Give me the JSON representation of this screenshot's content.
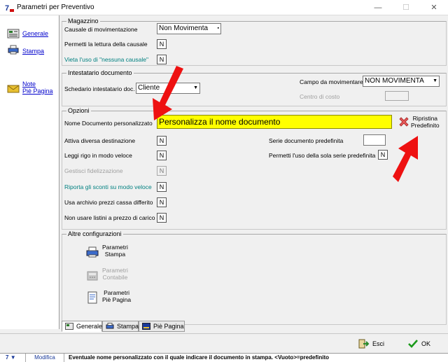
{
  "window": {
    "title": "Parametri per Preventivo",
    "minimize": "—",
    "maximize": "☐",
    "close": "✕"
  },
  "sidebar": {
    "items": [
      {
        "label": "Generale"
      },
      {
        "label": "Stampa"
      },
      {
        "label": "Note\nPiè Pagina"
      }
    ]
  },
  "magazzino": {
    "title": "Magazzino",
    "causale_label": "Causale di movimentazione",
    "causale_value": "Non Movimenta",
    "lettura_label": "Permetti la lettura della causale",
    "lettura_value": "N",
    "vieta_label": "Vieta l'uso di  \"nessuna causale\"",
    "vieta_value": "N"
  },
  "intestatario": {
    "title": "Intestatario documento",
    "schedario_label": "Schedario intestatario doc.",
    "schedario_value": "Cliente",
    "campo_label": "Campo da movimentare",
    "campo_value": "NON MOVIMENTA",
    "centro_label": "Centro di costo"
  },
  "opzioni": {
    "title": "Opzioni",
    "nome_label": "Nome Documento personalizzato",
    "nome_value": "Personalizza il nome documento",
    "ripristina_label": "Ripristina\nPredefinito",
    "destinazione_label": "Attiva diversa destinazione",
    "destinazione_value": "N",
    "rigo_label": "Leggi rigo in modo veloce",
    "rigo_value": "N",
    "fidel_label": "Gestisci fidelizzazione",
    "fidel_value": "N",
    "sconti_label": "Riporta gli sconti su modo veloce",
    "sconti_value": "N",
    "archivio_label": "Usa archivio prezzi cassa differito",
    "archivio_value": "N",
    "listini_label": "Non usare listini a prezzo di carico",
    "listini_value": "N",
    "serie_label": "Serie documento predefinita",
    "sola_serie_label": "Permetti l'uso della sola serie predefinita",
    "sola_serie_value": "N"
  },
  "altre": {
    "title": "Altre configurazioni",
    "items": [
      {
        "label": "Parametri\nStampa",
        "enabled": true
      },
      {
        "label": "Parametri\nContabile",
        "enabled": false
      },
      {
        "label": "Parametri\nPiè Pagina",
        "enabled": true
      }
    ]
  },
  "tabs": [
    {
      "label": "Generale",
      "active": true
    },
    {
      "label": "Stampa",
      "active": false
    },
    {
      "label": "Piè Pagina",
      "active": false
    }
  ],
  "buttons": {
    "esci": "Esci",
    "ok": "OK"
  },
  "status": {
    "num": "7",
    "mode": "Modifica",
    "message": "Eventuale nome personalizzato con il quale indicare il documento in stampa. <Vuoto>=predefinito"
  },
  "colors": {
    "highlight": "#ffff00",
    "link": "#0000cc",
    "teal": "#008080",
    "arrow": "#ee1111",
    "status_blue": "#1a3a9a"
  }
}
